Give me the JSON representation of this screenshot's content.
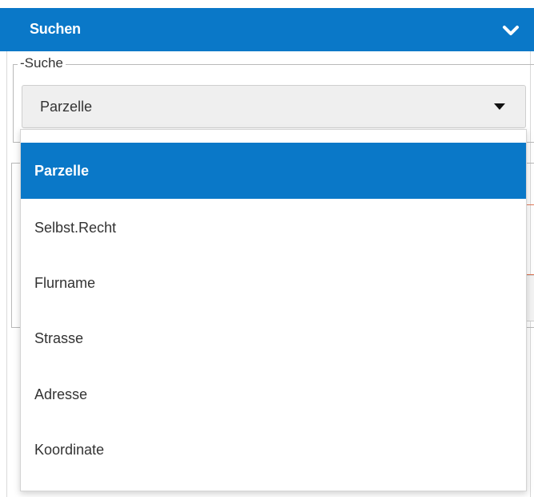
{
  "panel": {
    "title": "Suchen",
    "collapse_icon": "chevron-down-icon"
  },
  "search": {
    "legend": "-Suche",
    "selected_value": "Parzelle",
    "dropdown_icon": "caret-down-icon",
    "options": [
      {
        "label": "Parzelle",
        "selected": true
      },
      {
        "label": "Selbst.Recht",
        "selected": false
      },
      {
        "label": "Flurname",
        "selected": false
      },
      {
        "label": "Strasse",
        "selected": false
      },
      {
        "label": "Adresse",
        "selected": false
      },
      {
        "label": "Koordinate",
        "selected": false
      }
    ]
  },
  "colors": {
    "accent": "#0a78c8",
    "header_text": "#ffffff",
    "text": "#333333",
    "select_background": "#efefef",
    "error_border": "#e07a5a"
  }
}
